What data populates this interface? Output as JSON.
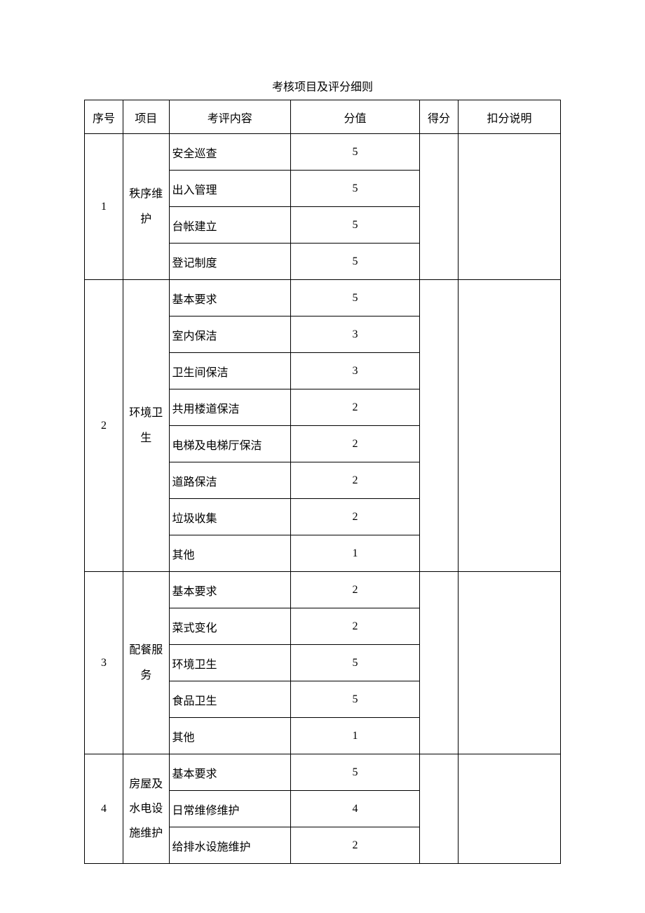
{
  "title": "考核项目及评分细则",
  "headers": {
    "seq": "序号",
    "project": "项目",
    "content": "考评内容",
    "score": "分值",
    "got": "得分",
    "explain": "扣分说明"
  },
  "groups": [
    {
      "seq": "1",
      "project": "秩序维\n护",
      "rows": [
        {
          "content": "安全巡查",
          "score": "5"
        },
        {
          "content": "出入管理",
          "score": "5"
        },
        {
          "content": "台帐建立",
          "score": "5"
        },
        {
          "content": "登记制度",
          "score": "5"
        }
      ]
    },
    {
      "seq": "2",
      "project": "环境卫\n生",
      "rows": [
        {
          "content": "基本要求",
          "score": "5"
        },
        {
          "content": "室内保洁",
          "score": "3"
        },
        {
          "content": "卫生间保洁",
          "score": "3"
        },
        {
          "content": "共用楼道保洁",
          "score": "2"
        },
        {
          "content": "电梯及电梯厅保洁",
          "score": "2"
        },
        {
          "content": "道路保洁",
          "score": "2"
        },
        {
          "content": "垃圾收集",
          "score": "2"
        },
        {
          "content": "其他",
          "score": "1"
        }
      ]
    },
    {
      "seq": "3",
      "project": "配餐服\n务",
      "rows": [
        {
          "content": "基本要求",
          "score": "2"
        },
        {
          "content": "菜式变化",
          "score": "2"
        },
        {
          "content": "环境卫生",
          "score": "5"
        },
        {
          "content": "食品卫生",
          "score": "5"
        },
        {
          "content": "其他",
          "score": "1"
        }
      ]
    },
    {
      "seq": "4",
      "project": "房屋及\n水电设\n施维护",
      "rows": [
        {
          "content": "基本要求",
          "score": "5"
        },
        {
          "content": "日常维修维护",
          "score": "4"
        },
        {
          "content": "给排水设施维护",
          "score": "2"
        }
      ]
    }
  ]
}
